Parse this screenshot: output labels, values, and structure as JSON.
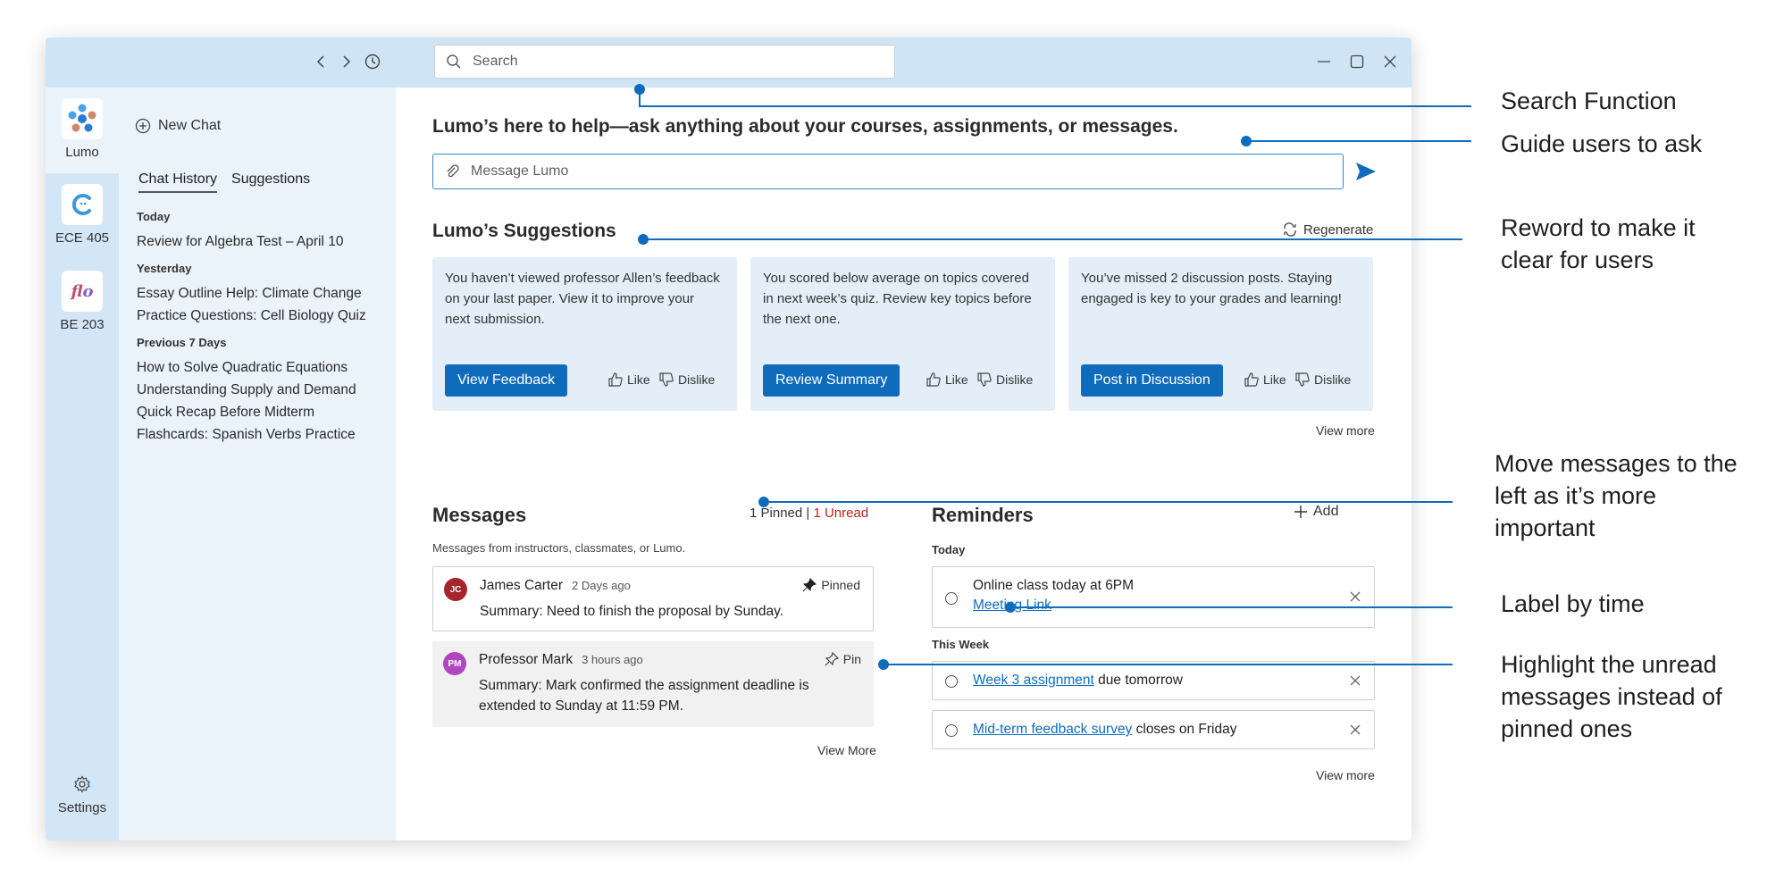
{
  "titlebar": {
    "search_placeholder": "Search",
    "back_icon": "chevron-left-icon",
    "forward_icon": "chevron-right-icon",
    "history_icon": "clock-icon"
  },
  "rail": {
    "items": [
      {
        "label": "Lumo",
        "icon": "lumo-logo-icon"
      },
      {
        "label": "ECE 405",
        "icon": "course-c-icon"
      },
      {
        "label": "BE 203",
        "icon": "flo-logo-icon"
      }
    ],
    "settings_label": "Settings"
  },
  "panel": {
    "new_chat_label": "New Chat",
    "tabs": [
      "Chat History",
      "Suggestions"
    ],
    "groups": [
      {
        "label": "Today",
        "items": [
          "Review for Algebra Test – April 10"
        ]
      },
      {
        "label": "Yesterday",
        "items": [
          "Essay Outline Help: Climate Change",
          "Practice Questions: Cell Biology Quiz"
        ]
      },
      {
        "label": "Previous 7 Days",
        "items": [
          "How to Solve Quadratic Equations",
          "Understanding Supply and Demand",
          "Quick Recap Before Midterm",
          "Flashcards: Spanish Verbs Practice"
        ]
      }
    ]
  },
  "main": {
    "headline": "Lumo’s here to help—ask anything about your courses, assignments, or messages.",
    "message_placeholder": "Message Lumo",
    "suggestions_title": "Lumo’s Suggestions",
    "regenerate_label": "Regenerate",
    "cards": [
      {
        "text": "You haven’t viewed professor Allen’s feedback on your last paper. View it to improve your next submission.",
        "button": "View Feedback",
        "like": "Like",
        "dislike": "Dislike"
      },
      {
        "text": "You scored below average on topics covered in next week’s quiz. Review key topics before the next one.",
        "button": "Review Summary",
        "like": "Like",
        "dislike": "Dislike"
      },
      {
        "text": "You’ve missed 2 discussion posts. Staying engaged is key to your grades and learning!",
        "button": "Post in Discussion",
        "like": "Like",
        "dislike": "Dislike"
      }
    ],
    "suggestions_view_more": "View more",
    "messages": {
      "title": "Messages",
      "pinned_count": "1 Pinned |",
      "unread_count": "1 Unread",
      "caption": "Messages from instructors, classmates, or Lumo.",
      "items": [
        {
          "initials": "JC",
          "avatar_color": "#a4262c",
          "name": "James Carter",
          "time": "2 Days ago",
          "pin_label": "Pinned",
          "body": "Summary: Need to finish the proposal by Sunday."
        },
        {
          "initials": "PM",
          "avatar_color": "#b146c2",
          "name": "Professor Mark",
          "time": "3 hours ago",
          "pin_label": "Pin",
          "body": "Summary: Mark confirmed the assignment deadline is extended to Sunday at 11:59 PM."
        }
      ],
      "view_more": "View More"
    },
    "reminders": {
      "title": "Reminders",
      "add_label": "Add",
      "today_label": "Today",
      "week_label": "This Week",
      "today_item": {
        "text": "Online class today at 6PM",
        "link": "Meeting Link"
      },
      "week_items": [
        {
          "link": "Week 3 assignment",
          "text": " due tomorrow"
        },
        {
          "link": "Mid-term feedback survey",
          "text": " closes on Friday"
        }
      ],
      "view_more": "View more"
    }
  },
  "annotations": [
    "Search Function",
    "Guide users to ask",
    "Reword to make it clear for users",
    "Move messages to the left as it’s more important",
    "Label by time",
    "Highlight the unread messages instead of pinned ones"
  ],
  "colors": {
    "accent": "#0f6cbd",
    "annotation_line": "#0f6cbd",
    "titlebar": "#cfe4f4",
    "rail": "#d3e6f6"
  }
}
